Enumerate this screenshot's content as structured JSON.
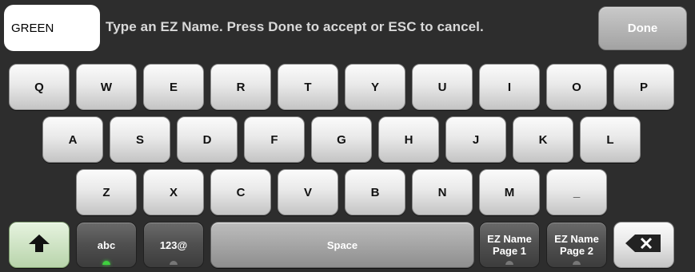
{
  "input": {
    "value": "GREEN"
  },
  "prompt": "Type an EZ Name.  Press Done to accept or ESC to cancel.",
  "done_label": "Done",
  "rows": {
    "row1": [
      "Q",
      "W",
      "E",
      "R",
      "T",
      "Y",
      "U",
      "I",
      "O",
      "P"
    ],
    "row2": [
      "A",
      "S",
      "D",
      "F",
      "G",
      "H",
      "J",
      "K",
      "L"
    ],
    "row3": [
      "Z",
      "X",
      "C",
      "V",
      "B",
      "N",
      "M",
      "_"
    ]
  },
  "bottom": {
    "shift_icon": "up-arrow-icon",
    "abc_label": "abc",
    "abc_active": true,
    "num_label": "123@",
    "num_active": false,
    "space_label": "Space",
    "ez_page1_label_1": "EZ Name",
    "ez_page1_label_2": "Page 1",
    "ez_page1_active": false,
    "ez_page2_label_1": "EZ Name",
    "ez_page2_label_2": "Page 2",
    "ez_page2_active": false,
    "backspace_icon": "backspace-icon"
  },
  "colors": {
    "background": "#2d2d2d",
    "led_on": "#3fd03f",
    "led_off": "#777777",
    "shift_active": "#b8d4ab"
  }
}
